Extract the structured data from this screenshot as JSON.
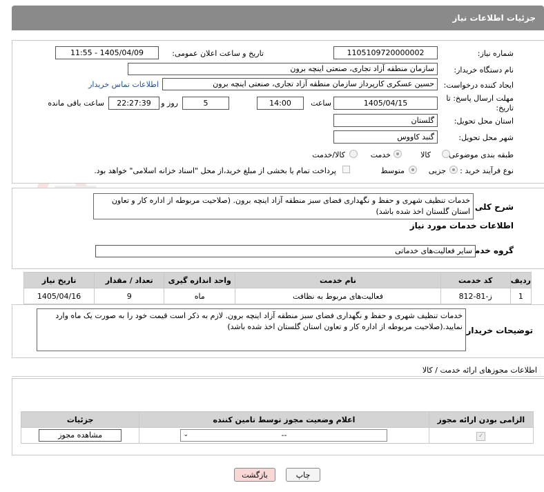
{
  "header": {
    "title": "جزئیات اطلاعات نیاز"
  },
  "fields": {
    "need_number_label": "شماره نیاز:",
    "need_number": "1105109720000002",
    "announce_label": "تاریخ و ساعت اعلان عمومی:",
    "announce_value": "1405/04/09 - 11:55",
    "buyer_org_label": "نام دستگاه خریدار:",
    "buyer_org": "سازمان منطقه آزاد تجاری، صنعتی اینچه برون",
    "creator_label": "ایجاد کننده درخواست:",
    "creator": "حسین عسکری کارپرداز سازمان منطقه آزاد تجاری، صنعتی اینچه برون",
    "contact_link": "اطلاعات تماس خریدار",
    "deadline_label": "مهلت ارسال پاسخ: تا تاریخ:",
    "deadline_date": "1405/04/15",
    "time_label": "ساعت",
    "deadline_time": "14:00",
    "days_value": "5",
    "days_label": "روز و",
    "remaining_time": "22:27:39",
    "remaining_label": "ساعت باقی مانده",
    "province_label": "استان محل تحویل:",
    "province": "گلستان",
    "city_label": "شهر محل تحویل:",
    "city": "گنبد کاووس",
    "category_label": "طبقه بندی موضوعی:",
    "cat_goods": "کالا",
    "cat_service": "خدمت",
    "cat_goods_service": "کالا/خدمت",
    "process_label": "نوع فرآیند خرید :",
    "proc_small": "جزیی",
    "proc_medium": "متوسط",
    "payment_note": "پرداخت تمام یا بخشی از مبلغ خرید،از محل \"اسناد خزانه اسلامی\" خواهد بود."
  },
  "summary": {
    "label": "شرح کلی نیاز:",
    "text": "خدمات تنظیف شهری و حفظ و نگهداری فضای سبز منطقه آزاد اینچه برون. (صلاحیت مربوطه از اداره کار و تعاون استان گلستان اخذ شده باشد)"
  },
  "services_section": {
    "title": "اطلاعات خدمات مورد نیاز"
  },
  "service_group": {
    "label": "گروه خدمت:",
    "value": "سایر فعالیت‌های خدماتی"
  },
  "table": {
    "headers": [
      "ردیف",
      "کد خدمت",
      "نام خدمت",
      "واحد اندازه گیری",
      "تعداد / مقدار",
      "تاریخ نیاز"
    ],
    "rows": [
      [
        "1",
        "ز-81-812",
        "فعالیت‌های مربوط به نظافت",
        "ماه",
        "9",
        "1405/04/16"
      ]
    ]
  },
  "buyer_notes": {
    "label": "توضیحات خریدار:",
    "text": "خدمات تنظیف شهری و حفظ و نگهداری فضای سبز منطقه آزاد اینچه برون. لازم به ذکر است قیمت خود را به صورت یک ماه وارد نمایید.(صلاحیت مربوطه از اداره کار و تعاون استان گلستان اخذ شده باشد)"
  },
  "permits": {
    "title": "اطلاعات مجوزهای ارائه خدمت / کالا",
    "headers": [
      "الزامی بودن ارائه مجوز",
      "اعلام وضعیت مجوز توسط تامین کننده",
      "جزئیات"
    ],
    "select_value": "--",
    "view_button": "مشاهده مجوز"
  },
  "buttons": {
    "print": "چاپ",
    "back": "بازگشت"
  },
  "watermark": {
    "text": "AriaTender.neT"
  }
}
